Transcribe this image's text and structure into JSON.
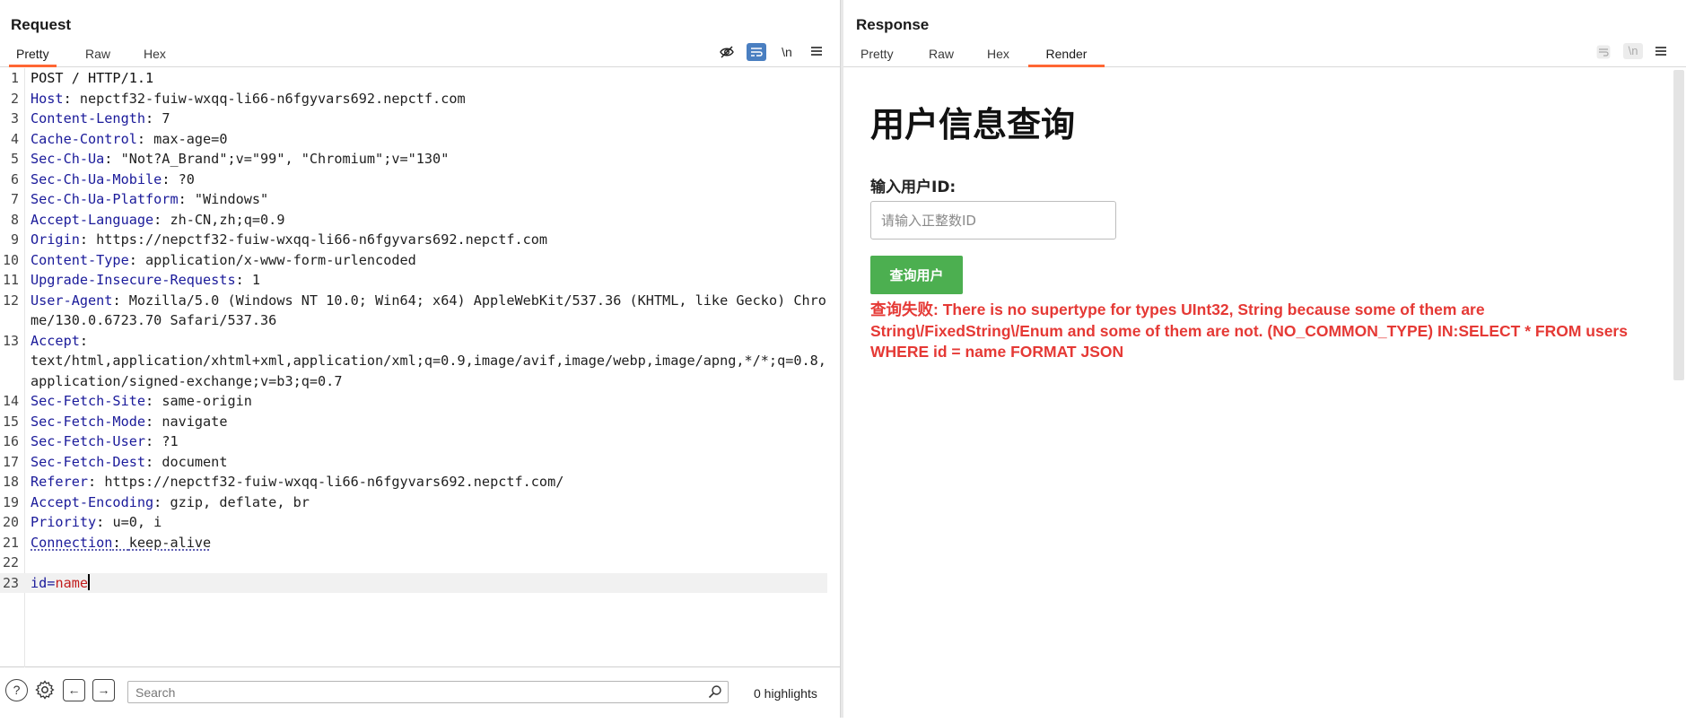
{
  "request": {
    "title": "Request",
    "tabs": [
      "Pretty",
      "Raw",
      "Hex"
    ],
    "active_tab": "Pretty",
    "newline_label": "\\n",
    "lines": [
      {
        "n": "1",
        "raw": "POST / HTTP/1.1"
      },
      {
        "n": "2",
        "k": "Host",
        "v": "nepctf32-fuiw-wxqq-li66-n6fgyvars692.nepctf.com"
      },
      {
        "n": "3",
        "k": "Content-Length",
        "v": "7"
      },
      {
        "n": "4",
        "k": "Cache-Control",
        "v": "max-age=0"
      },
      {
        "n": "5",
        "k": "Sec-Ch-Ua",
        "v": "\"Not?A_Brand\";v=\"99\", \"Chromium\";v=\"130\""
      },
      {
        "n": "6",
        "k": "Sec-Ch-Ua-Mobile",
        "v": "?0"
      },
      {
        "n": "7",
        "k": "Sec-Ch-Ua-Platform",
        "v": "\"Windows\""
      },
      {
        "n": "8",
        "k": "Accept-Language",
        "v": "zh-CN,zh;q=0.9"
      },
      {
        "n": "9",
        "k": "Origin",
        "v": "https://nepctf32-fuiw-wxqq-li66-n6fgyvars692.nepctf.com"
      },
      {
        "n": "10",
        "k": "Content-Type",
        "v": "application/x-www-form-urlencoded"
      },
      {
        "n": "11",
        "k": "Upgrade-Insecure-Requests",
        "v": "1"
      },
      {
        "n": "12",
        "k": "User-Agent",
        "v": "Mozilla/5.0 (Windows NT 10.0; Win64; x64) AppleWebKit/537.36 (KHTML, like Gecko) Chrome/130.0.6723.70 Safari/537.36"
      },
      {
        "n": "13",
        "k": "Accept",
        "v": "text/html,application/xhtml+xml,application/xml;q=0.9,image/avif,image/webp,image/apng,*/*;q=0.8,application/signed-exchange;v=b3;q=0.7"
      },
      {
        "n": "14",
        "k": "Sec-Fetch-Site",
        "v": "same-origin"
      },
      {
        "n": "15",
        "k": "Sec-Fetch-Mode",
        "v": "navigate"
      },
      {
        "n": "16",
        "k": "Sec-Fetch-User",
        "v": "?1"
      },
      {
        "n": "17",
        "k": "Sec-Fetch-Dest",
        "v": "document"
      },
      {
        "n": "18",
        "k": "Referer",
        "v": "https://nepctf32-fuiw-wxqq-li66-n6fgyvars692.nepctf.com/"
      },
      {
        "n": "19",
        "k": "Accept-Encoding",
        "v": "gzip, deflate, br"
      },
      {
        "n": "20",
        "k": "Priority",
        "v": "u=0, i"
      },
      {
        "n": "21",
        "k": "Connection",
        "v": "keep-alive"
      },
      {
        "n": "22",
        "raw": ""
      },
      {
        "n": "23",
        "pk": "id",
        "pv": "name"
      }
    ]
  },
  "search": {
    "placeholder": "Search",
    "highlights": "0 highlights"
  },
  "response": {
    "title": "Response",
    "tabs": [
      "Pretty",
      "Raw",
      "Hex",
      "Render"
    ],
    "active_tab": "Render",
    "newline_label": "\\n",
    "render": {
      "heading": "用户信息查询",
      "label": "输入用户ID:",
      "input_placeholder": "请输入正整数ID",
      "button": "查询用户",
      "error": "查询失败: There is no supertype for types UInt32, String because some of them are String\\/FixedString\\/Enum and some of them are not. (NO_COMMON_TYPE) IN:SELECT * FROM users WHERE id = name FORMAT JSON"
    }
  },
  "colors": {
    "accent_tab": "#ff6633",
    "header_key": "#1a1a9a",
    "param_value": "#c21d1d",
    "error_text": "#e53935",
    "button_green": "#4caf50",
    "toggle_blue": "#2f66ad"
  },
  "icons": {
    "request_tools": [
      "eye-off-icon",
      "wrap-icon",
      "newline-icon",
      "menu-icon"
    ],
    "response_tools": [
      "wrap-icon",
      "newline-icon",
      "menu-icon"
    ],
    "footer": [
      "help-icon",
      "settings-icon",
      "arrow-left-icon",
      "arrow-right-icon",
      "search-icon"
    ],
    "layout": [
      "split-columns-icon",
      "split-rows-icon",
      "tabs-icon"
    ]
  }
}
